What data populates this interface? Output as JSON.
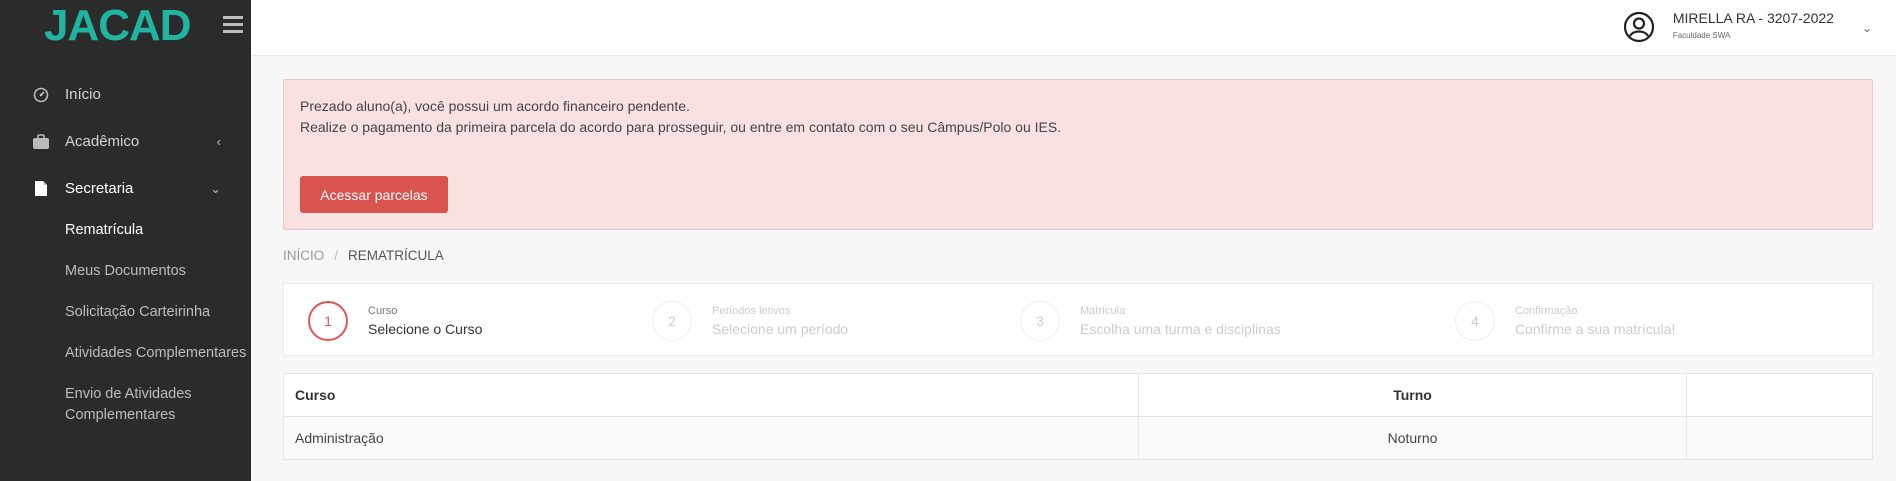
{
  "brand": {
    "logo": "JACAD"
  },
  "user": {
    "name": "MIRELLA RA - 3207-2022",
    "institution": "Faculdade SWA"
  },
  "sidebar": {
    "items": [
      {
        "label": "Início",
        "icon": "dashboard-icon"
      },
      {
        "label": "Acadêmico",
        "icon": "briefcase-icon"
      },
      {
        "label": "Secretaria",
        "icon": "document-icon"
      }
    ],
    "submenu": [
      "Rematrícula",
      "Meus Documentos",
      "Solicitação Carteirinha",
      "Atividades Complementares",
      "Envio de Atividades Complementares"
    ]
  },
  "alert": {
    "line1": "Prezado aluno(a), você possui um acordo financeiro pendente.",
    "line2": "Realize o pagamento da primeira parcela do acordo para prosseguir, ou entre em contato com o seu Câmpus/Polo ou IES.",
    "button": "Acessar parcelas"
  },
  "breadcrumb": {
    "home": "INÍCIO",
    "separator": "/",
    "current": "REMATRÍCULA"
  },
  "steps": [
    {
      "number": "1",
      "title": "Curso",
      "subtitle": "Selecione o Curso"
    },
    {
      "number": "2",
      "title": "Períodos letivos",
      "subtitle": "Selecione um período"
    },
    {
      "number": "3",
      "title": "Matrícula",
      "subtitle": "Escolha uma turma e disciplinas"
    },
    {
      "number": "4",
      "title": "Confirmação",
      "subtitle": "Confirme a sua matrícula!"
    }
  ],
  "table": {
    "headers": [
      "Curso",
      "Turno",
      ""
    ],
    "rows": [
      [
        "Administração",
        "Noturno",
        ""
      ]
    ]
  },
  "colors": {
    "accent": "#1fb5a0",
    "danger": "#d9534f",
    "sidebar": "#2b2b2b"
  }
}
